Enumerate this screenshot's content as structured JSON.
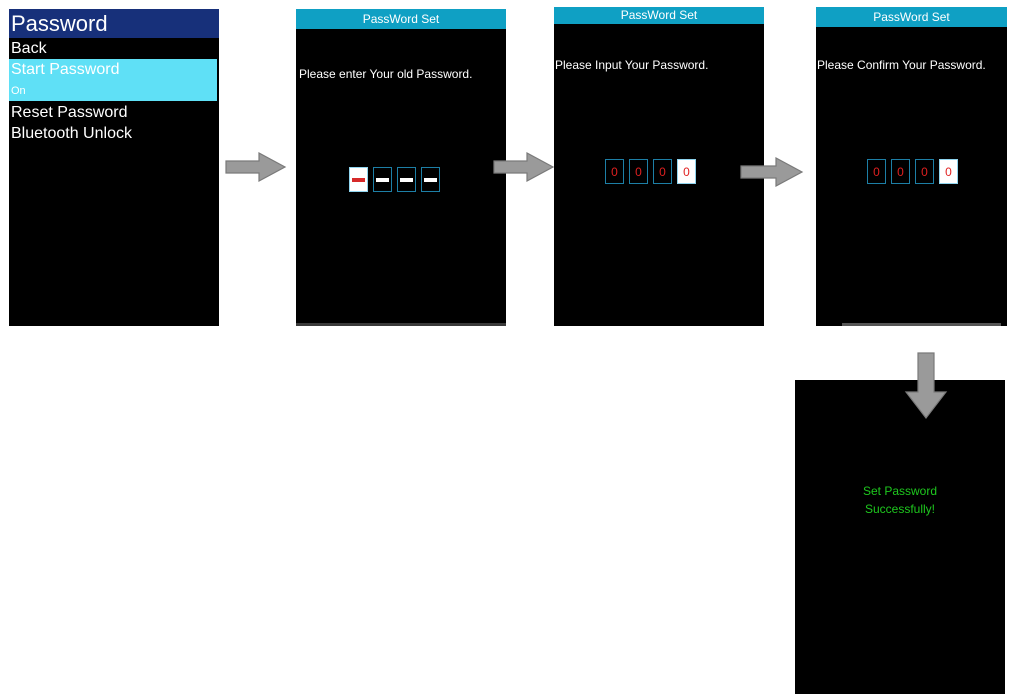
{
  "menu": {
    "title": "Password",
    "items": [
      "Back",
      "Start Password",
      "Reset Password",
      "Bluetooth Unlock"
    ],
    "selected_sub": "On"
  },
  "old_password_screen": {
    "header": "PassWord Set",
    "prompt": "Please enter Your old Password."
  },
  "input_password_screen": {
    "header": "PassWord Set",
    "prompt": "Please Input Your Password.",
    "digits": [
      "0",
      "0",
      "0",
      "0"
    ]
  },
  "confirm_password_screen": {
    "header": "PassWord Set",
    "prompt": "Please Confirm Your Password.",
    "digits": [
      "0",
      "0",
      "0",
      "0"
    ]
  },
  "success_screen": {
    "line1": "Set Password",
    "line2": "Successfully!"
  },
  "colors": {
    "header_bg": "#0fa0c4",
    "menu_title_bg": "#17307a",
    "selected_bg": "#5fe0f6",
    "digit_color": "#e02020",
    "success_color": "#1ec81e",
    "arrow": "#909090"
  }
}
